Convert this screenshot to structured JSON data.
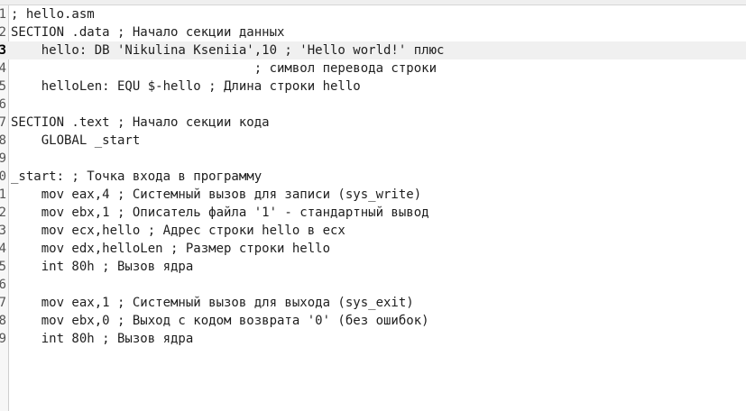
{
  "editor": {
    "current_line": 3,
    "lines": [
      {
        "number": "1",
        "text": "; hello.asm"
      },
      {
        "number": "2",
        "text": "SECTION .data ; Начало секции данных"
      },
      {
        "number": "3",
        "text": "    hello: DB 'Nikulina Kseniia',10 ; 'Hello world!' плюс"
      },
      {
        "number": "4",
        "text": "                                ; символ перевода строки"
      },
      {
        "number": "5",
        "text": "    helloLen: EQU $-hello ; Длина строки hello"
      },
      {
        "number": "6",
        "text": ""
      },
      {
        "number": "7",
        "text": "SECTION .text ; Начало секции кода"
      },
      {
        "number": "8",
        "text": "    GLOBAL _start"
      },
      {
        "number": "9",
        "text": ""
      },
      {
        "number": "0",
        "text": "_start: ; Точка входа в программу"
      },
      {
        "number": "1",
        "text": "    mov eax,4 ; Системный вызов для записи (sys_write)"
      },
      {
        "number": "2",
        "text": "    mov ebx,1 ; Описатель файла '1' - стандартный вывод"
      },
      {
        "number": "3",
        "text": "    mov ecx,hello ; Адрес строки hello в ecx"
      },
      {
        "number": "4",
        "text": "    mov edx,helloLen ; Размер строки hello"
      },
      {
        "number": "5",
        "text": "    int 80h ; Вызов ядра"
      },
      {
        "number": "6",
        "text": ""
      },
      {
        "number": "7",
        "text": "    mov eax,1 ; Системный вызов для выхода (sys_exit)"
      },
      {
        "number": "8",
        "text": "    mov ebx,0 ; Выход с кодом возврата '0' (без ошибок)"
      },
      {
        "number": "9",
        "text": "    int 80h ; Вызов ядра"
      }
    ]
  }
}
